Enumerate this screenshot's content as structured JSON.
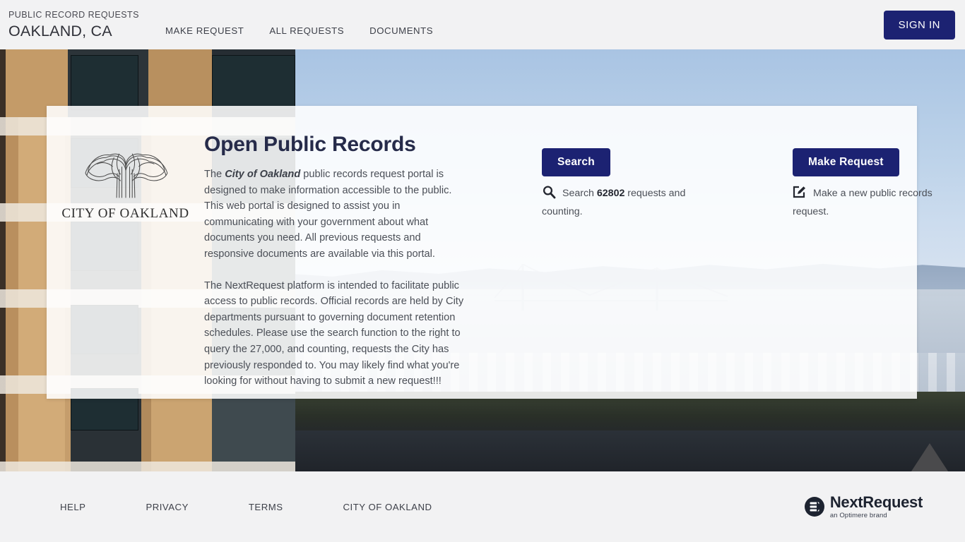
{
  "header": {
    "eyebrow": "PUBLIC RECORD REQUESTS",
    "title": "OAKLAND, CA",
    "nav": [
      {
        "label": "MAKE REQUEST",
        "name": "nav-make-request"
      },
      {
        "label": "ALL REQUESTS",
        "name": "nav-all-requests"
      },
      {
        "label": "DOCUMENTS",
        "name": "nav-documents"
      }
    ],
    "sign_in_label": "SIGN IN"
  },
  "hero": {
    "agency_logo_caption_main": "CITY",
    "agency_logo_caption_of": "OF",
    "agency_logo_caption_city": "OAKLAND",
    "agency_logo_caption": "CITY OF OAKLAND",
    "title": "Open Public Records",
    "paragraph_1_pre": "The ",
    "paragraph_1_em": "City of Oakland",
    "paragraph_1_post": " public records request portal is designed to make information accessible to the public.  This web portal is designed to assist you in communicating with your government about what documents you need. All previous requests and responsive documents are available via this portal.",
    "paragraph_2": "The NextRequest platform is intended to facilitate public access to public records. Official records are held by City departments pursuant to governing document retention schedules. Please use the search function to the right to query the 27,000, and counting, requests the City has previously responded to. You may likely find what you're looking for without having to submit a new request!!!",
    "search": {
      "button_label": "Search",
      "desc_pre": "Search ",
      "count": "62802",
      "desc_post": " requests and counting.",
      "icon": "search-icon"
    },
    "make_request": {
      "button_label": "Make Request",
      "desc": "Make a new public records request.",
      "icon": "edit-square-icon"
    }
  },
  "footer": {
    "links": [
      {
        "label": "HELP",
        "name": "footer-link-help"
      },
      {
        "label": "PRIVACY",
        "name": "footer-link-privacy"
      },
      {
        "label": "TERMS",
        "name": "footer-link-terms"
      },
      {
        "label": "CITY OF OAKLAND",
        "name": "footer-link-city-of-oakland"
      }
    ],
    "logo_name": "NextRequest",
    "logo_tagline": "an Optimere brand"
  },
  "colors": {
    "navy": "#1c2272",
    "header_bg": "#f2f2f3",
    "title": "#262b4a",
    "body_text": "#4b4f57"
  }
}
